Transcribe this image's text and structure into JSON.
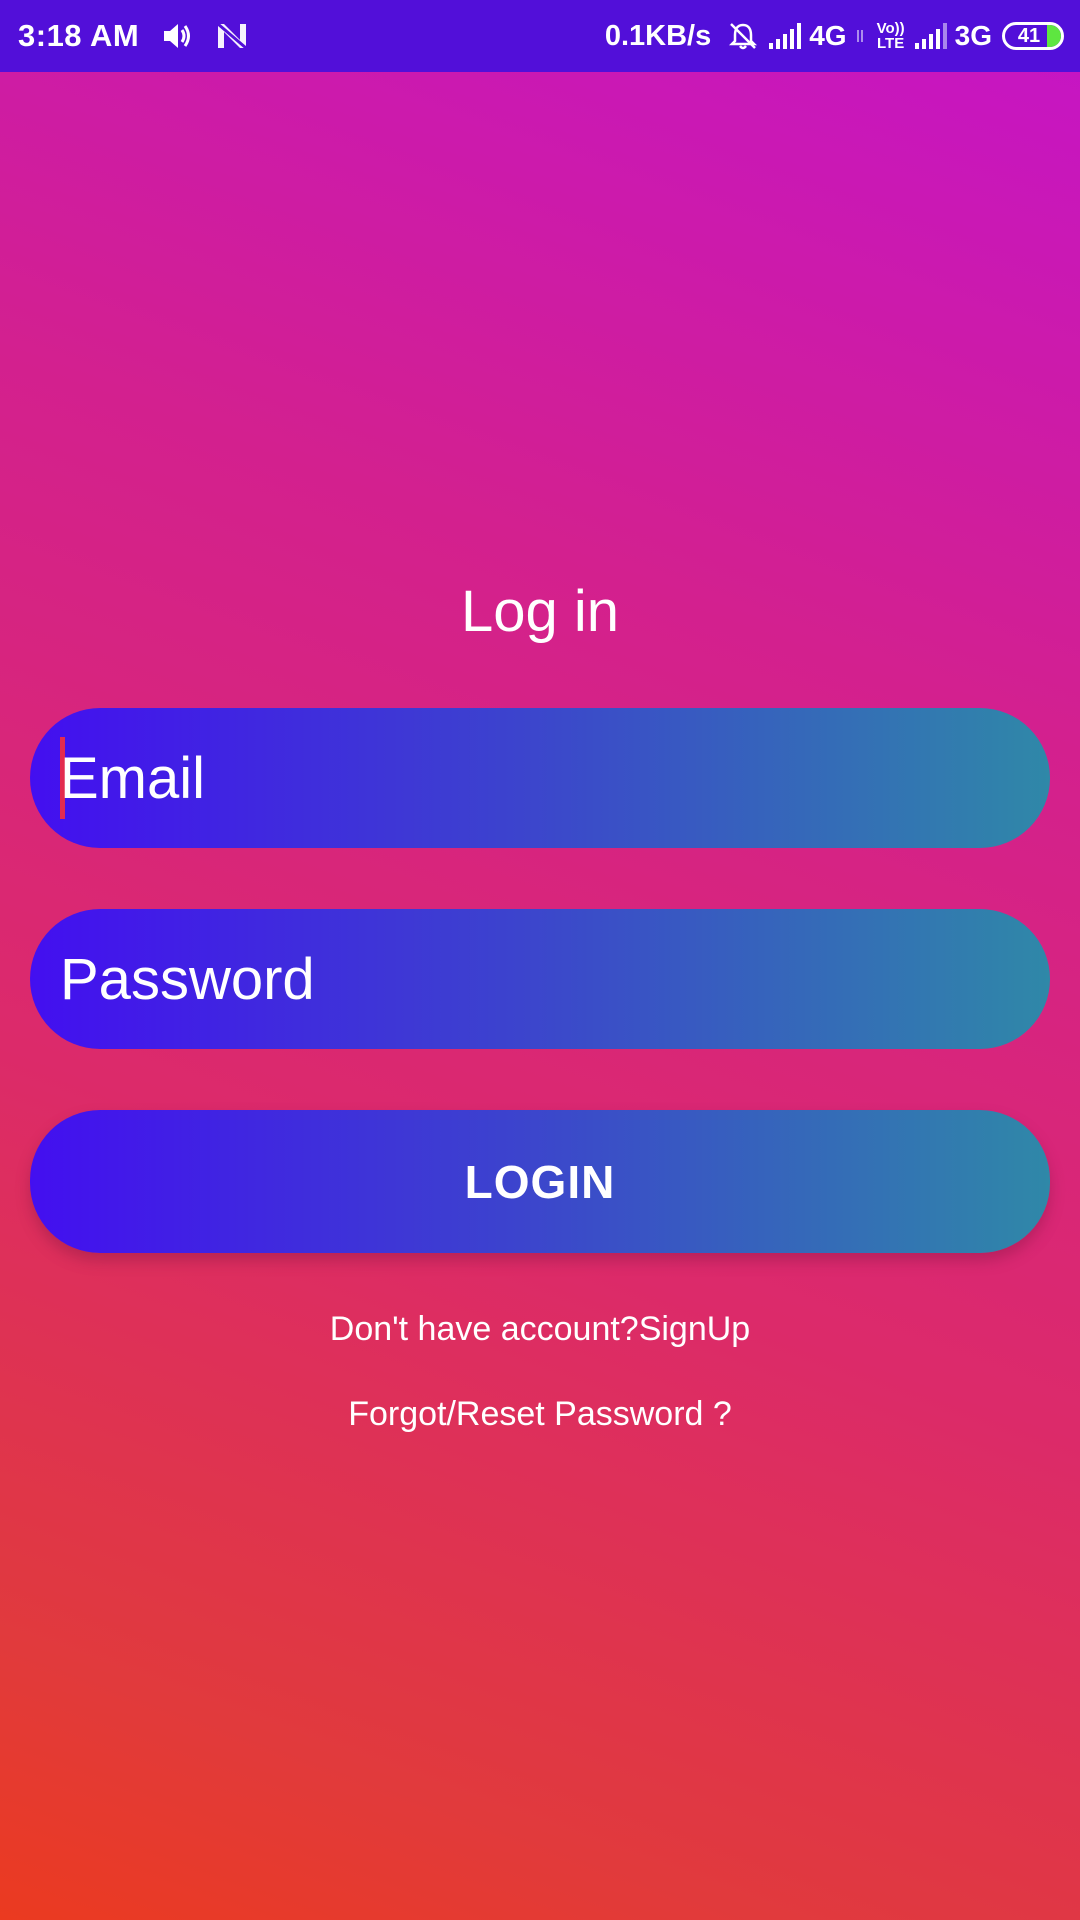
{
  "status_bar": {
    "time": "3:18 AM",
    "icons": [
      "volume-icon",
      "notification-n-icon",
      "alarm-off-icon",
      "signal-icon",
      "volte-icon",
      "signal-icon-2"
    ],
    "net_speed": "0.1KB/s",
    "network_1": "4G",
    "volte_line1": "Vo))",
    "volte_line2": "LTE",
    "network_2": "3G",
    "battery": "41",
    "battery_color": "#5ee640",
    "background": "#520fd9"
  },
  "login": {
    "title": "Log in",
    "email_placeholder": "Email",
    "password_placeholder": "Password",
    "login_button": "LOGIN",
    "signup_link": "Don't have account?SignUp",
    "forgot_link": "Forgot/Reset Password ?"
  },
  "colors": {
    "background_top": "#c514c8",
    "background_bottom": "#eb3a20",
    "field_gradient_start": "#430ff0",
    "field_gradient_end": "#2f88a8",
    "caret": "#e32b4f"
  }
}
